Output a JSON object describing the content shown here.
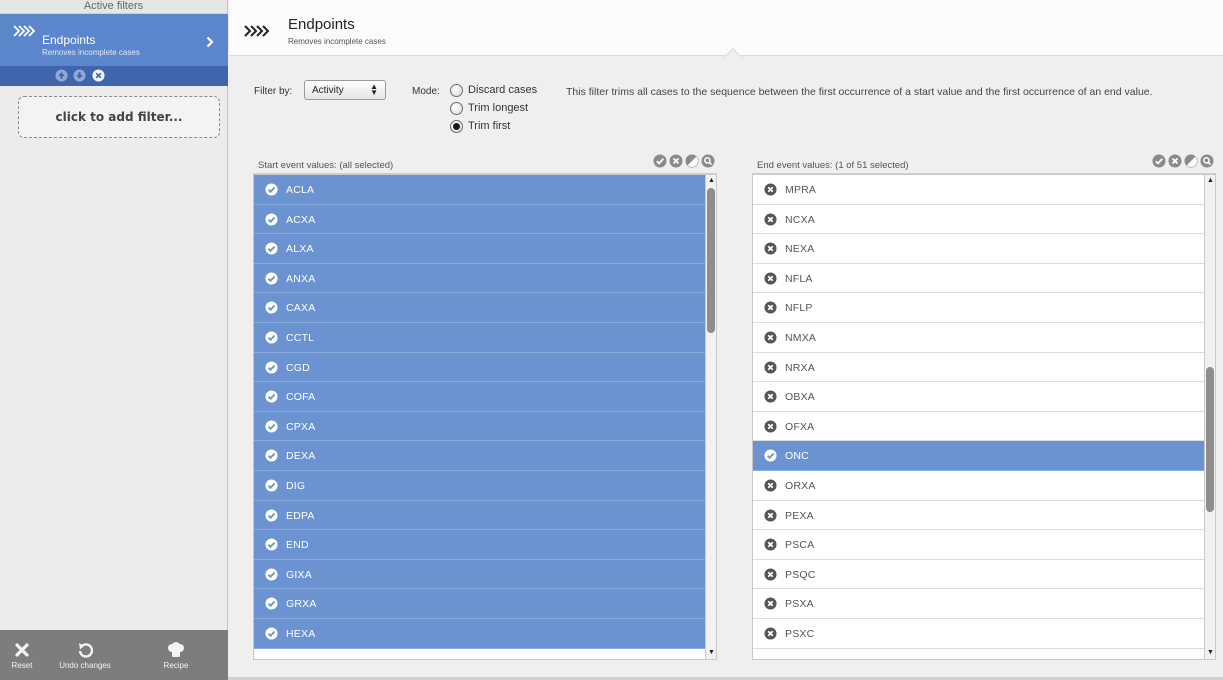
{
  "sidebar": {
    "title": "Active filters",
    "active_filter": {
      "name": "Endpoints",
      "description": "Removes incomplete cases"
    },
    "add_filter_label": "click to add filter...",
    "bottom_buttons": [
      {
        "label": "Reset",
        "icon": "x-icon"
      },
      {
        "label": "Undo changes",
        "icon": "undo-icon"
      },
      {
        "label": "Recipe",
        "icon": "chef-hat-icon"
      }
    ]
  },
  "header": {
    "title": "Endpoints",
    "subtitle": "Removes incomplete cases"
  },
  "filter_bar": {
    "filter_by_label": "Filter by:",
    "filter_by_value": "Activity",
    "mode_label": "Mode:",
    "modes": [
      {
        "label": "Discard cases",
        "selected": false
      },
      {
        "label": "Trim longest",
        "selected": false
      },
      {
        "label": "Trim first",
        "selected": true
      }
    ],
    "description": "This filter trims all cases to the sequence between the first occurrence of a start value and the first occurrence of an end value."
  },
  "start_panel": {
    "title": "Start event values:  (all selected)",
    "scroll_position": 0.0,
    "items": [
      {
        "label": "ACLA",
        "selected": true
      },
      {
        "label": "ACXA",
        "selected": true
      },
      {
        "label": "ALXA",
        "selected": true
      },
      {
        "label": "ANXA",
        "selected": true
      },
      {
        "label": "CAXA",
        "selected": true
      },
      {
        "label": "CCTL",
        "selected": true
      },
      {
        "label": "CGD",
        "selected": true
      },
      {
        "label": "COFA",
        "selected": true
      },
      {
        "label": "CPXA",
        "selected": true
      },
      {
        "label": "DEXA",
        "selected": true
      },
      {
        "label": "DIG",
        "selected": true
      },
      {
        "label": "EDPA",
        "selected": true
      },
      {
        "label": "END",
        "selected": true
      },
      {
        "label": "GIXA",
        "selected": true
      },
      {
        "label": "GRXA",
        "selected": true
      },
      {
        "label": "HEXA",
        "selected": true
      }
    ]
  },
  "end_panel": {
    "title": "End event values:  (1 of 51 selected)",
    "scroll_position": 0.5,
    "items": [
      {
        "label": "MPRA",
        "selected": false
      },
      {
        "label": "NCXA",
        "selected": false
      },
      {
        "label": "NEXA",
        "selected": false
      },
      {
        "label": "NFLA",
        "selected": false
      },
      {
        "label": "NFLP",
        "selected": false
      },
      {
        "label": "NMXA",
        "selected": false
      },
      {
        "label": "NRXA",
        "selected": false
      },
      {
        "label": "OBXA",
        "selected": false
      },
      {
        "label": "OFXA",
        "selected": false
      },
      {
        "label": "ONC",
        "selected": true
      },
      {
        "label": "ORXA",
        "selected": false
      },
      {
        "label": "PEXA",
        "selected": false
      },
      {
        "label": "PSCA",
        "selected": false
      },
      {
        "label": "PSQC",
        "selected": false
      },
      {
        "label": "PSXA",
        "selected": false
      },
      {
        "label": "PSXC",
        "selected": false
      }
    ]
  },
  "panel_tools": [
    "select-all-icon",
    "deselect-all-icon",
    "invert-selection-icon",
    "search-icon"
  ],
  "colors": {
    "selected_row": "#6b93d1",
    "sidebar_active": "#5b86cc",
    "sidebar_controls": "#3f66ad"
  }
}
